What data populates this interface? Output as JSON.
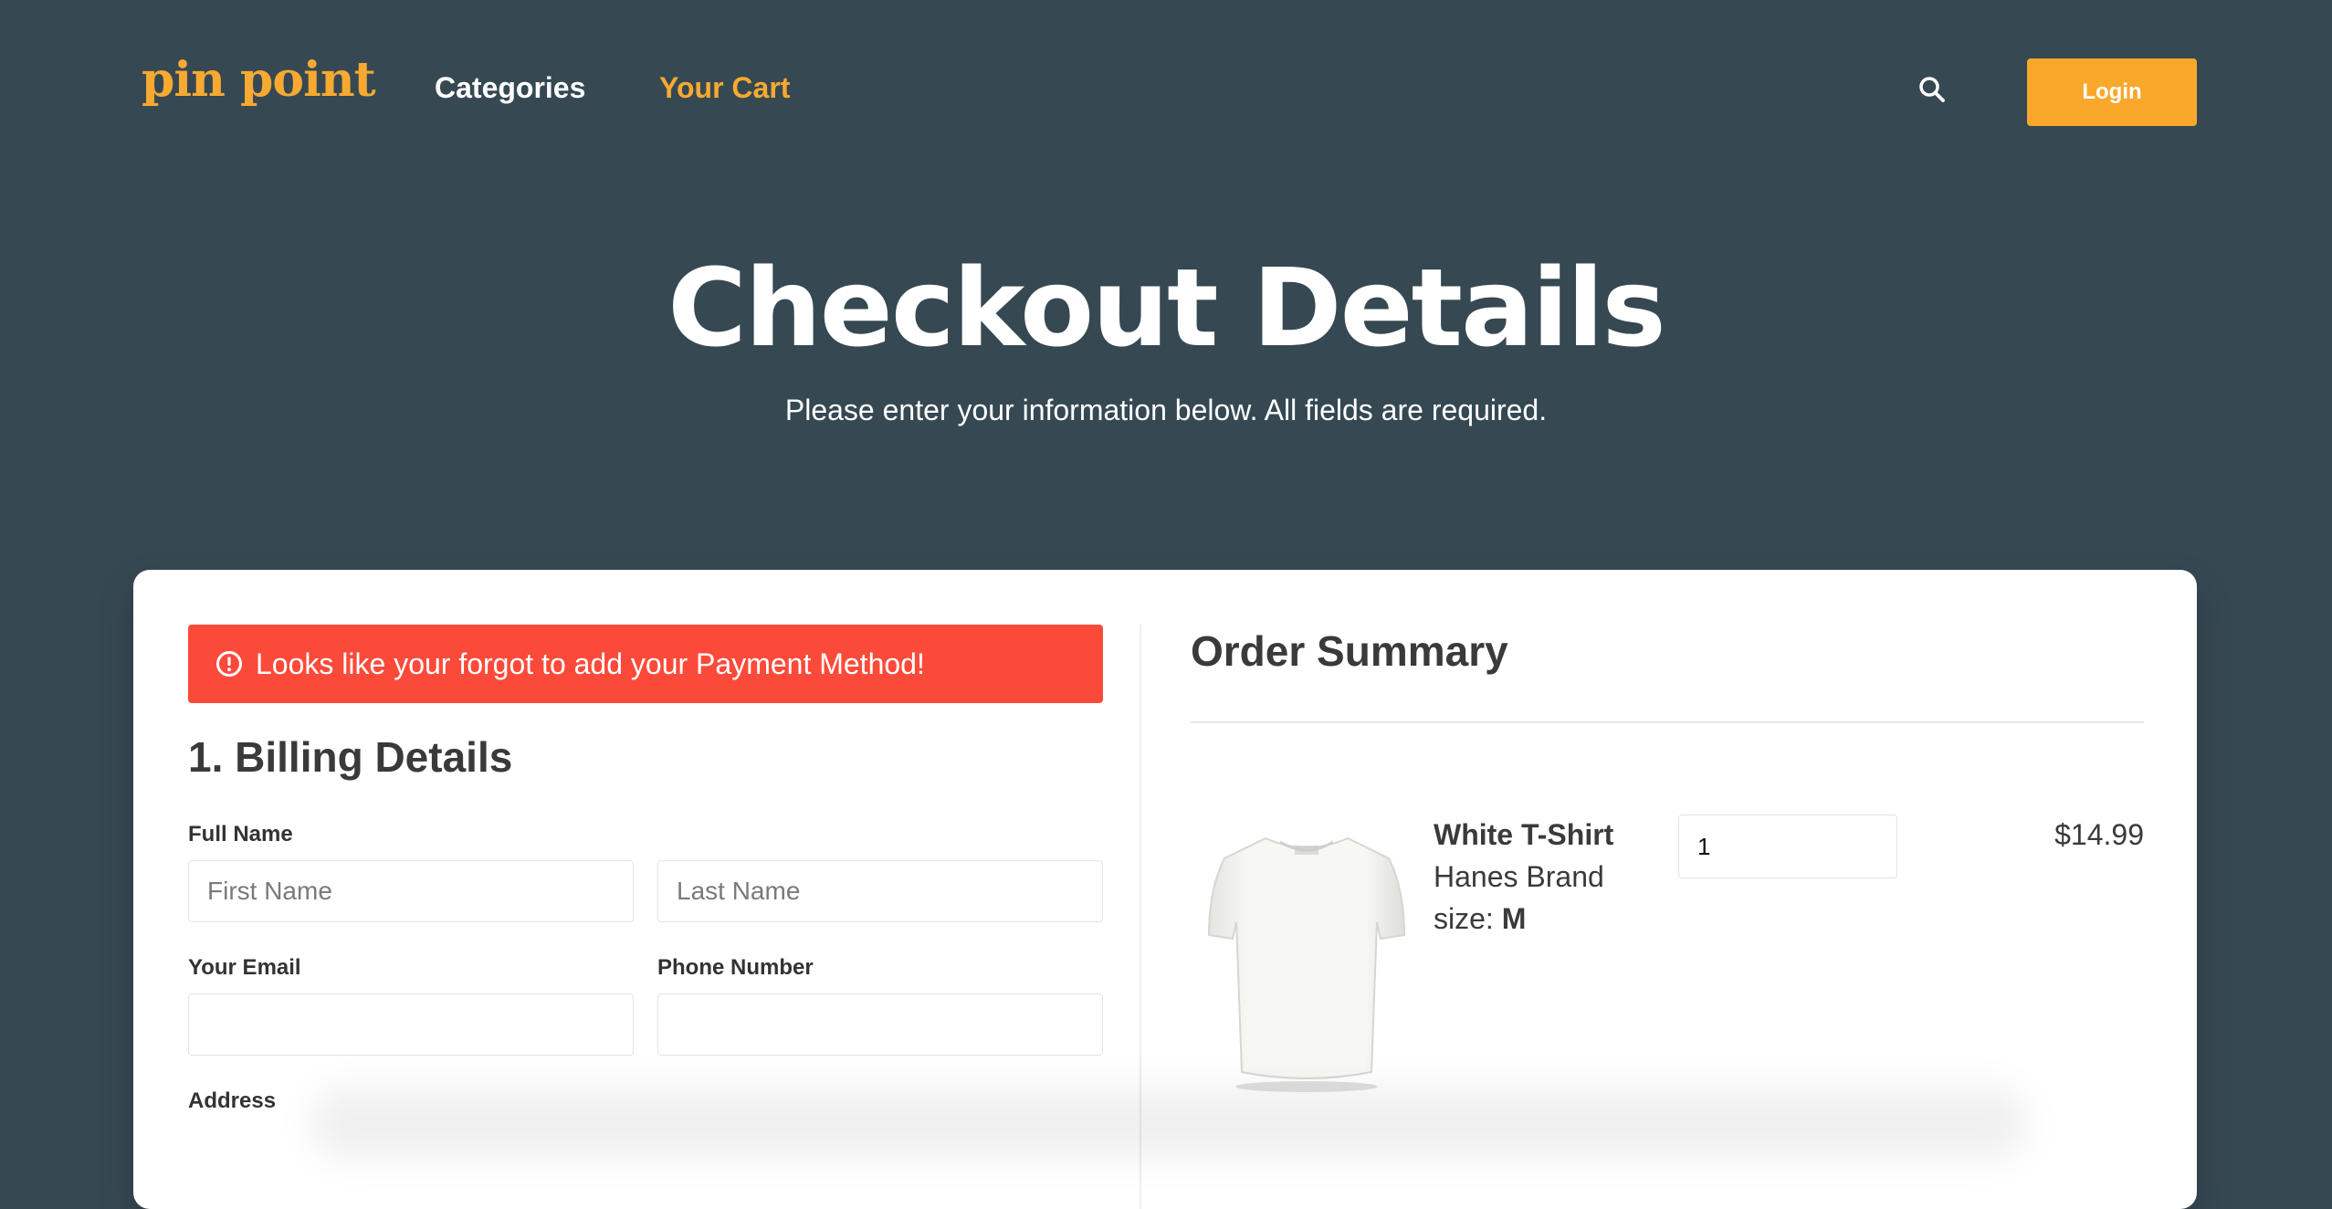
{
  "brand": {
    "logo_text": "pin point",
    "accent_color": "#f7a931"
  },
  "nav": {
    "links": [
      {
        "label": "Categories",
        "active": false
      },
      {
        "label": "Your Cart",
        "active": true
      }
    ],
    "search_icon": "search-icon",
    "login_label": "Login"
  },
  "hero": {
    "title": "Checkout Details",
    "subtitle": "Please enter your information below. All fields are required."
  },
  "alert": {
    "icon": "exclamation-circle-icon",
    "message": "Looks like your forgot to add your Payment Method!",
    "color": "#fc4a3a"
  },
  "billing": {
    "section_title": "1. Billing Details",
    "full_name_label": "Full Name",
    "first_name_placeholder": "First Name",
    "last_name_placeholder": "Last Name",
    "email_label": "Your Email",
    "email_value": "",
    "phone_label": "Phone Number",
    "phone_value": "",
    "address_label": "Address"
  },
  "order_summary": {
    "title": "Order Summary",
    "items": [
      {
        "name": "White T-Shirt",
        "brand": "Hanes Brand",
        "size_label": "size:",
        "size_value": "M",
        "quantity": "1",
        "price": "$14.99"
      }
    ]
  }
}
